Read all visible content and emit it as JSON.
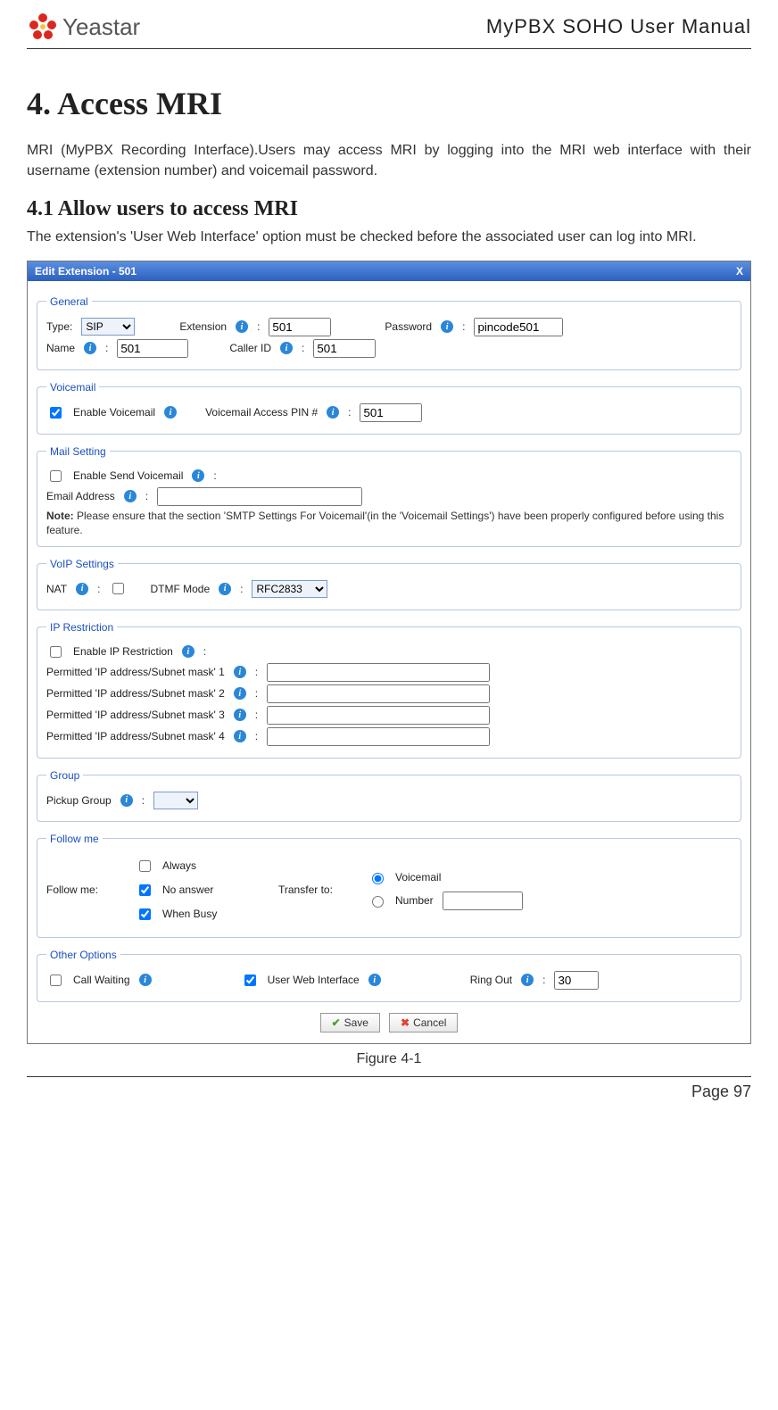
{
  "header": {
    "logo_text": "Yeastar",
    "doc_title": "MyPBX SOHO User Manual"
  },
  "chapter_title": "4. Access MRI",
  "intro_para": "MRI (MyPBX Recording Interface).Users may access MRI by logging into the MRI web interface with their username (extension number) and voicemail password.",
  "section_title": "4.1 Allow users to access MRI",
  "section_para": "The extension's 'User Web Interface' option must be checked before the associated user can log into MRI.",
  "dialog": {
    "title": "Edit Extension - 501",
    "close": "X",
    "general": {
      "legend": "General",
      "type_label": "Type:",
      "type_value": "SIP",
      "extension_label": "Extension",
      "extension_value": "501",
      "password_label": "Password",
      "password_value": "pincode501",
      "name_label": "Name",
      "name_value": "501",
      "callerid_label": "Caller ID",
      "callerid_value": "501"
    },
    "voicemail": {
      "legend": "Voicemail",
      "enable_label": "Enable Voicemail",
      "enable_checked": true,
      "pin_label": "Voicemail Access PIN #",
      "pin_value": "501"
    },
    "mail": {
      "legend": "Mail Setting",
      "enable_send_label": "Enable Send Voicemail",
      "enable_send_checked": false,
      "email_label": "Email Address",
      "email_value": "",
      "note_prefix": "Note:",
      "note_text": " Please ensure that the section 'SMTP Settings For Voicemail'(in the 'Voicemail Settings') have been properly configured before using this feature."
    },
    "voip": {
      "legend": "VoIP Settings",
      "nat_label": "NAT",
      "nat_checked": false,
      "dtmf_label": "DTMF Mode",
      "dtmf_value": "RFC2833"
    },
    "ipr": {
      "legend": "IP Restriction",
      "enable_label": "Enable IP Restriction",
      "enable_checked": false,
      "perm_label_1": "Permitted 'IP address/Subnet mask' 1",
      "perm_label_2": "Permitted 'IP address/Subnet mask' 2",
      "perm_label_3": "Permitted 'IP address/Subnet mask' 3",
      "perm_label_4": "Permitted 'IP address/Subnet mask' 4"
    },
    "group": {
      "legend": "Group",
      "pickup_label": "Pickup Group",
      "pickup_value": ""
    },
    "follow": {
      "legend": "Follow me",
      "follow_label": "Follow me:",
      "always_label": "Always",
      "always_checked": false,
      "noanswer_label": "No answer",
      "noanswer_checked": true,
      "whenbusy_label": "When Busy",
      "whenbusy_checked": true,
      "transfer_label": "Transfer to:",
      "voicemail_label": "Voicemail",
      "voicemail_selected": true,
      "number_label": "Number",
      "number_value": ""
    },
    "other": {
      "legend": "Other Options",
      "callwaiting_label": "Call Waiting",
      "callwaiting_checked": false,
      "userweb_label": "User Web Interface",
      "userweb_checked": true,
      "ringout_label": "Ring Out",
      "ringout_value": "30"
    },
    "buttons": {
      "save": "Save",
      "cancel": "Cancel"
    }
  },
  "figure_caption": "Figure 4-1",
  "page_number": "Page 97"
}
